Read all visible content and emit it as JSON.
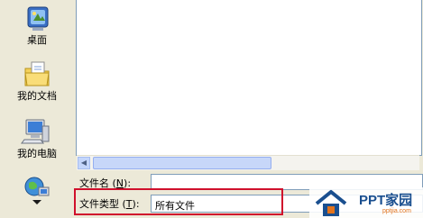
{
  "places_bar": {
    "items": [
      {
        "label": "桌面",
        "icon": "desktop-icon"
      },
      {
        "label": "我的文档",
        "icon": "my-documents-icon"
      },
      {
        "label": "我的电脑",
        "icon": "my-computer-icon"
      },
      {
        "label": "",
        "icon": "network-places-icon"
      }
    ]
  },
  "file_name": {
    "label_prefix": "文件名",
    "hotkey_open": " (",
    "hotkey": "N",
    "hotkey_close": ")",
    "colon": ":",
    "value": ""
  },
  "file_type": {
    "label_prefix": "文件类型",
    "hotkey_open": " (",
    "hotkey": "T",
    "hotkey_close": ")",
    "colon": ":",
    "value": "所有文件"
  },
  "watermark": {
    "brand": "PPT家园",
    "url": "pptjia.com",
    "colors": {
      "brand": "#1a4f8f",
      "accent": "#e2731c"
    }
  },
  "highlight_color": "#d0102c"
}
